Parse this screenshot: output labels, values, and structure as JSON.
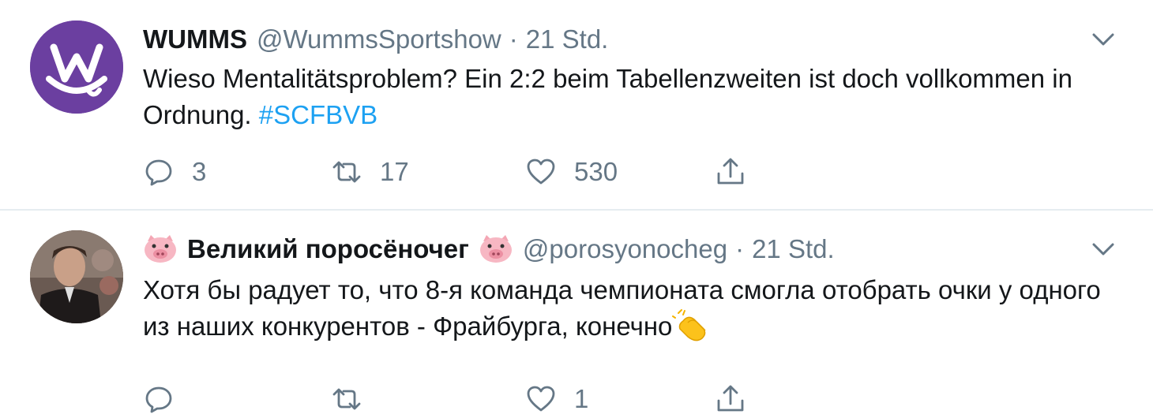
{
  "tweets": [
    {
      "name": "WUMMS",
      "handle": "@WummsSportshow",
      "separator": "·",
      "time": "21 Std.",
      "text": "Wieso Mentalitätsproblem? Ein 2:2 beim Tabellenzweiten ist doch vollkommen in Ordnung. ",
      "hashtag": "#SCFBVB",
      "avatar_icon": "wumms-logo-icon",
      "replies": "3",
      "retweets": "17",
      "likes": "530"
    },
    {
      "name": "Великий поросёночег",
      "handle": "@porosyonocheg",
      "separator": "·",
      "time": "21 Std.",
      "text": "Хотя бы радует то, что 8-я команда чемпионата смогла отобрать очки у одного из наших конкурентов - Фрайбурга, конечно",
      "avatar_icon": "profile-photo",
      "name_emoji": "pig-face-icon",
      "text_emoji": "clapping-hands-icon",
      "replies": "",
      "retweets": "",
      "likes": "1"
    }
  ],
  "colors": {
    "accent": "#1da1f2",
    "secondary_text": "#657786",
    "primary_text": "#14171a",
    "divider": "#e6ecf0",
    "avatar_purple": "#6b3fa0"
  }
}
